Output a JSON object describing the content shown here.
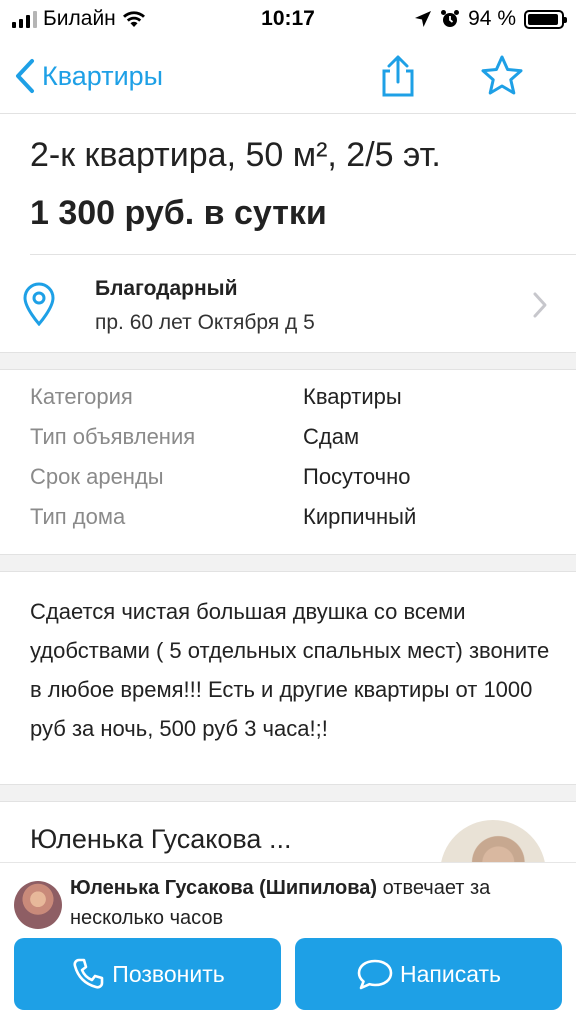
{
  "status_bar": {
    "carrier": "Билайн",
    "time": "10:17",
    "battery_percent": "94 %",
    "battery_level": 0.94,
    "icons": [
      "signal-icon",
      "wifi-icon",
      "location-arrow-icon",
      "alarm-icon",
      "battery-icon"
    ]
  },
  "nav": {
    "back_label": "Квартиры",
    "accent_color": "#1ea0e6",
    "icons": [
      "chevron-left-icon",
      "share-icon",
      "star-icon"
    ]
  },
  "listing": {
    "title": "2-к квартира, 50 м², 2/5 эт.",
    "price": "1 300 руб. в сутки"
  },
  "address": {
    "name": "Благодарный",
    "street": "пр. 60 лет Октября д 5"
  },
  "params": [
    {
      "label": "Категория",
      "value": "Квартиры"
    },
    {
      "label": "Тип объявления",
      "value": "Сдам"
    },
    {
      "label": "Срок аренды",
      "value": "Посуточно"
    },
    {
      "label": "Тип дома",
      "value": "Кирпичный"
    }
  ],
  "description": "Сдается чистая большая двушка со всеми удобствами ( 5 отдельных спальных мест) звоните в любое время!!!  Есть и другие квартиры от 1000 руб за ночь, 500 руб 3 часа!;!",
  "seller": {
    "name": "Юленька Гусакова ..."
  },
  "bottom": {
    "full_name": "Юленька Гусакова (Шипилова)",
    "reply_info": "отвечает за несколько часов",
    "call_label": "Позвонить",
    "write_label": "Написать"
  }
}
